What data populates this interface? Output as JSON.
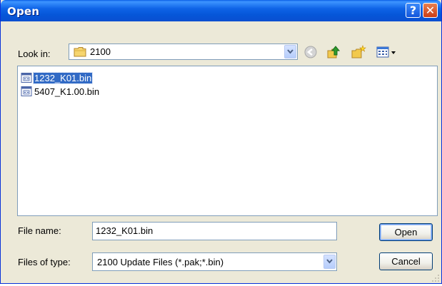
{
  "window": {
    "title": "Open",
    "help_label": "?",
    "close_label": "✕",
    "help_icon": "help-icon",
    "close_icon": "close-icon"
  },
  "toolbar": {
    "look_in_label": "Look in:",
    "look_in_value": "2100",
    "look_in_icon": "folder-icon",
    "tools": [
      "back-icon",
      "up-folder-icon",
      "new-folder-icon",
      "view-menu-icon"
    ]
  },
  "files": [
    {
      "name": "1232_K01.bin",
      "icon": "bin-file-icon",
      "selected": true
    },
    {
      "name": "5407_K1.00.bin",
      "icon": "bin-file-icon",
      "selected": false
    }
  ],
  "file_name": {
    "label": "File name:",
    "value": "1232_K01.bin"
  },
  "file_type": {
    "label": "Files of type:",
    "value": "2100 Update Files (*.pak;*.bin)"
  },
  "buttons": {
    "open": "Open",
    "cancel": "Cancel"
  },
  "colors": {
    "title_bar": "#0a5fe7",
    "selection": "#316ac5",
    "dialog_bg": "#ece9d8"
  }
}
